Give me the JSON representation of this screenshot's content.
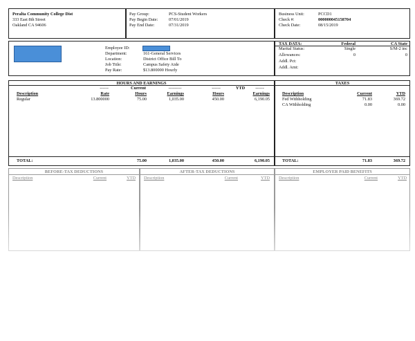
{
  "company": {
    "name": "Peralta Community College Dist",
    "address1": "333 East 8th Street",
    "address2": "Oakland CA  94606"
  },
  "pay_info": {
    "labels": [
      "Pay Group:",
      "Pay Begin Date:",
      "Pay End Date:"
    ],
    "values": [
      "PCS-Student Workers",
      "07/01/2019",
      "07/31/2019"
    ]
  },
  "business": {
    "labels": [
      "Business Unit:",
      "Check #:",
      "Check Date:"
    ],
    "values": [
      "PCCD1",
      "000000045158704",
      "08/15/2019"
    ]
  },
  "employee": {
    "labels": [
      "Employee ID:",
      "Department:",
      "Location:",
      "Job Title:",
      "Pay Rate:"
    ],
    "values": [
      "",
      "161-General Services",
      "District Office Bill To",
      "Campus Safety Aide",
      "$13.800000 Hourly"
    ]
  },
  "tax_data": {
    "title": "TAX DATA:",
    "col_federal": "Federal",
    "col_state": "CA State",
    "rows": [
      {
        "label": "Marital Status:",
        "federal": "Single",
        "state": "S/M-2 inc"
      },
      {
        "label": "Allowances:",
        "federal": "0",
        "state": "0"
      },
      {
        "label": "Addl. Pct:",
        "federal": "",
        "state": ""
      },
      {
        "label": "Addl. Amt:",
        "federal": "",
        "state": ""
      }
    ]
  },
  "earnings": {
    "title": "HOURS AND EARNINGS",
    "group_current": "Current",
    "group_ytd": "YTD",
    "dash": "------",
    "dash_long": "---------",
    "headers": [
      "Description",
      "Rate",
      "Hours",
      "Earnings",
      "Hours",
      "Earnings"
    ],
    "rows": [
      {
        "description": "Regular",
        "rate": "13.800000",
        "hours": "75.00",
        "earnings": "1,035.00",
        "ytd_hours": "450.00",
        "ytd_earnings": "6,190.05"
      }
    ],
    "total_label": "TOTAL:",
    "totals": {
      "hours": "75.00",
      "earnings": "1,035.00",
      "ytd_hours": "450.00",
      "ytd_earnings": "6,190.05"
    }
  },
  "taxes": {
    "title": "TAXES",
    "headers": [
      "Description",
      "Current",
      "YTD"
    ],
    "rows": [
      {
        "description": "Fed Withholding",
        "current": "71.83",
        "ytd": "369.72"
      },
      {
        "description": "CA Withholding",
        "current": "0.00",
        "ytd": "0.00"
      }
    ],
    "total_label": "TOTAL:",
    "totals": {
      "current": "71.83",
      "ytd": "369.72"
    }
  },
  "deductions": {
    "pre_tax": {
      "title": "BEFORE-TAX DEDUCTIONS",
      "headers": [
        "Description",
        "Current",
        "YTD"
      ]
    },
    "after_tax": {
      "title": "AFTER-TAX DEDUCTIONS",
      "headers": [
        "Description",
        "Current",
        "YTD"
      ]
    },
    "employer": {
      "title": "EMPLOYER PAID BENEFITS",
      "headers": [
        "Description",
        "Current",
        "YTD"
      ]
    },
    "colors": {
      "faded_text": "#888888",
      "redaction": "#4a8fd8"
    }
  }
}
